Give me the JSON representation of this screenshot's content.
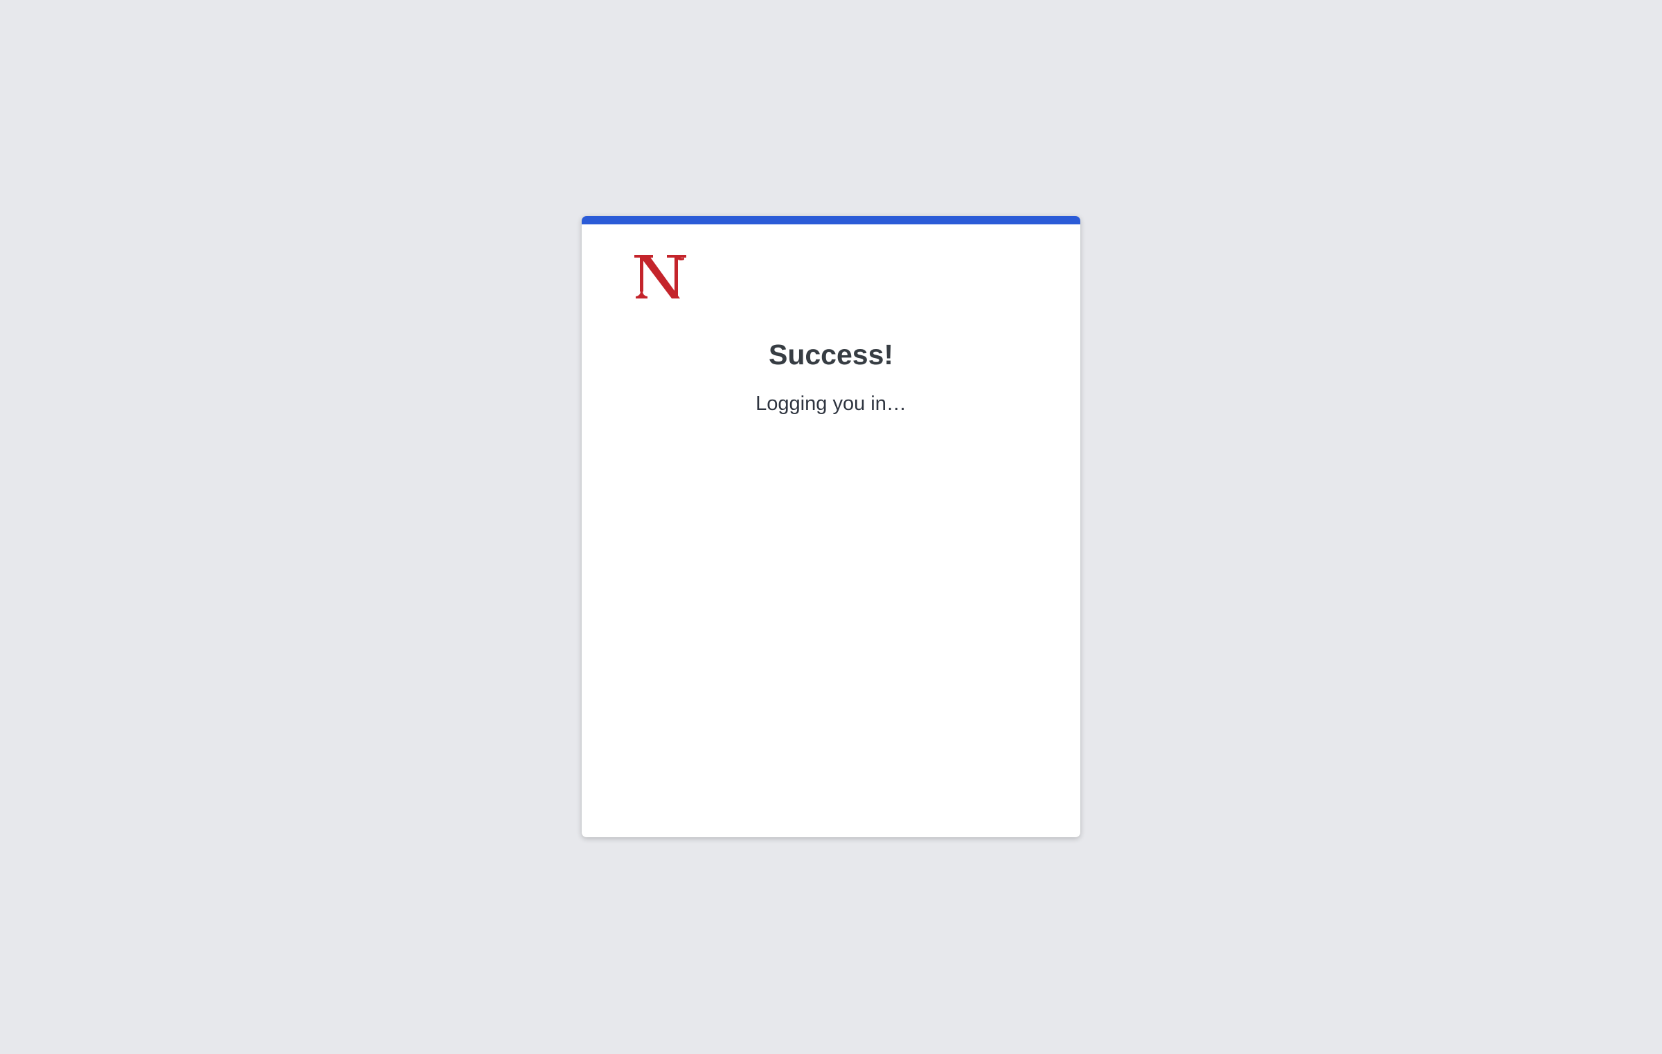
{
  "page": {
    "background_color": "#e7e8ec"
  },
  "card": {
    "accent_color": "#2b5bd7",
    "logo": {
      "icon": "northwestern-n-logo-icon",
      "letter": "N",
      "color": "#c4242b"
    },
    "title": "Success!",
    "title_color": "#373d43",
    "message": "Logging you in…",
    "message_color": "#2f3540"
  }
}
